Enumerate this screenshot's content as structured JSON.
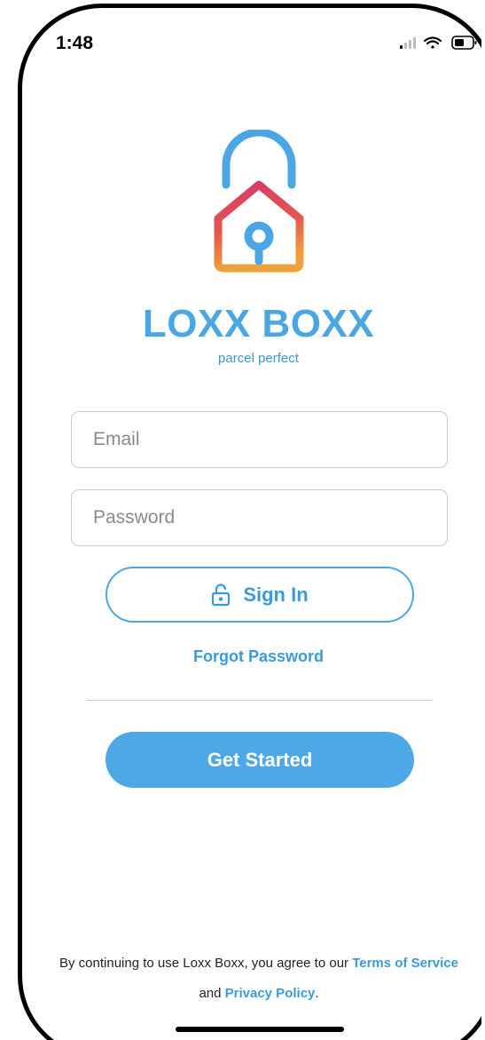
{
  "status_bar": {
    "time": "1:48",
    "signal_icon": "cellular-signal-icon",
    "wifi_icon": "wifi-icon",
    "battery_icon": "battery-icon"
  },
  "brand": {
    "logo_icon": "padlock-house-icon",
    "name": "LOXX BOXX",
    "tagline": "parcel perfect",
    "primary_color": "#4aa7e3",
    "gradient_colors": [
      "#d63a6a",
      "#f0a23a"
    ]
  },
  "form": {
    "email_placeholder": "Email",
    "email_value": "",
    "password_placeholder": "Password",
    "password_value": ""
  },
  "actions": {
    "sign_in_label": "Sign In",
    "sign_in_icon": "unlock-icon",
    "forgot_password_label": "Forgot Password",
    "get_started_label": "Get Started"
  },
  "legal": {
    "prefix": "By continuing to use Loxx Boxx, you agree to our",
    "terms_label": "Terms of Service",
    "and": "and",
    "privacy_label": "Privacy Policy",
    "suffix": "."
  }
}
